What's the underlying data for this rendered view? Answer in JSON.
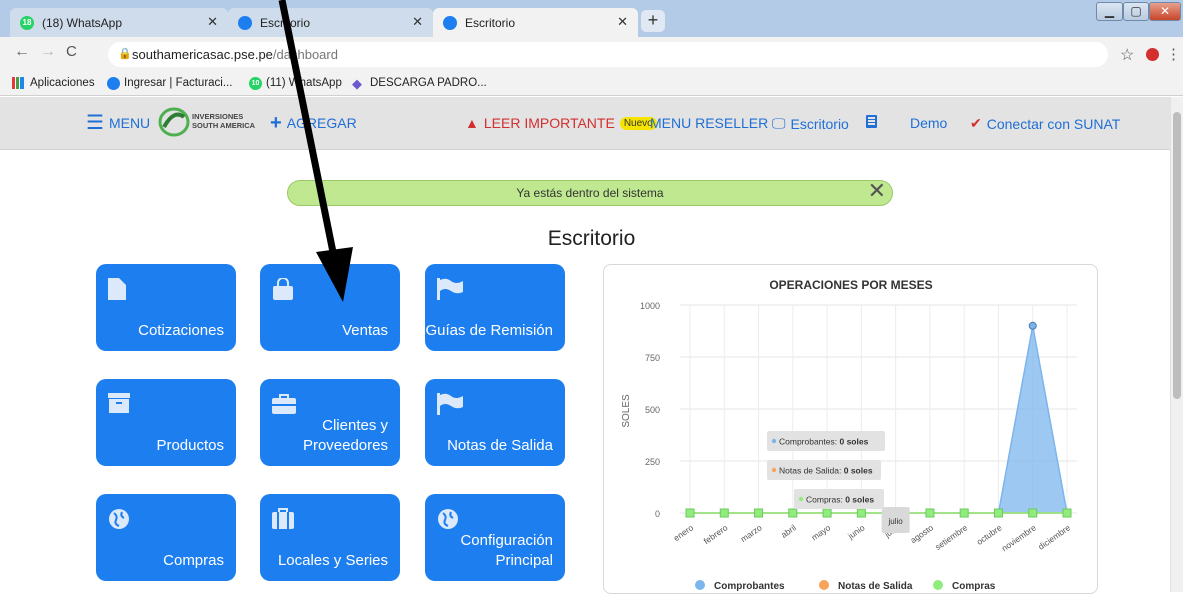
{
  "browser": {
    "tabs": [
      {
        "badge": "18",
        "label": "(18) WhatsApp"
      },
      {
        "label": "Escritorio"
      },
      {
        "label": "Escritorio"
      }
    ],
    "new_tab_label": "+",
    "url_host": "southamericasac.pse.pe",
    "url_path": "/dashboard"
  },
  "bookmarks": [
    {
      "label": "Aplicaciones"
    },
    {
      "label": "Ingresar | Facturaci..."
    },
    {
      "badge": "10",
      "label": "(11) WhatsApp"
    },
    {
      "label": "DESCARGA PADRO..."
    }
  ],
  "appnav": {
    "menu": "MENU",
    "logo_line1": "INVERSIONES",
    "logo_line2": "SOUTH AMERICA",
    "agregar": "AGREGAR",
    "leer": "LEER IMPORTANTE",
    "nuevo": "Nuevo",
    "reseller": "MENU RESELLER",
    "escritorio": "Escritorio",
    "demo": "Demo",
    "sunat": "Conectar con SUNAT"
  },
  "alert": {
    "text": "Ya estás dentro del sistema"
  },
  "page_title": "Escritorio",
  "tiles": [
    {
      "name": "tile-cotizaciones",
      "icon": "document-icon",
      "label": "Cotizaciones"
    },
    {
      "name": "tile-ventas",
      "icon": "shopping-bag-icon",
      "label": "Ventas"
    },
    {
      "name": "tile-guias",
      "icon": "flag-icon",
      "label": "Guías de Remisión"
    },
    {
      "name": "tile-productos",
      "icon": "archive-box-icon",
      "label": "Productos"
    },
    {
      "name": "tile-clientes",
      "icon": "briefcase-icon",
      "label": "Clientes y Proveedores"
    },
    {
      "name": "tile-notas",
      "icon": "flag-icon",
      "label": "Notas de Salida"
    },
    {
      "name": "tile-compras",
      "icon": "globe-icon",
      "label": "Compras"
    },
    {
      "name": "tile-locales",
      "icon": "luggage-icon",
      "label": "Locales y Series"
    },
    {
      "name": "tile-config",
      "icon": "globe-icon",
      "label": "Configuración Principal"
    }
  ],
  "chart_data": {
    "type": "area",
    "title": "OPERACIONES POR MESES",
    "ylabel": "SOLES",
    "ylim": [
      0,
      1000
    ],
    "yticks": [
      0,
      250,
      500,
      750,
      1000
    ],
    "grid": true,
    "legend": "bottom",
    "categories": [
      "enero",
      "febrero",
      "marzo",
      "abril",
      "mayo",
      "junio",
      "julio",
      "agosto",
      "setiembre",
      "octubre",
      "noviembre",
      "diciembre"
    ],
    "series": [
      {
        "name": "Comprobantes",
        "color": "#7cb5ec",
        "values": [
          0,
          0,
          0,
          0,
          0,
          0,
          0,
          0,
          0,
          0,
          900,
          0
        ]
      },
      {
        "name": "Notas de Salida",
        "color": "#f7a35c",
        "values": [
          0,
          0,
          0,
          0,
          0,
          0,
          0,
          0,
          0,
          0,
          0,
          0
        ]
      },
      {
        "name": "Compras",
        "color": "#90ed7d",
        "values": [
          0,
          0,
          0,
          0,
          0,
          0,
          0,
          0,
          0,
          0,
          0,
          0
        ]
      }
    ],
    "tooltip": {
      "category": "julio",
      "lines": [
        {
          "series": "Comprobantes",
          "text": "Comprobantes: ",
          "value": "0 soles"
        },
        {
          "series": "Notas de Salida",
          "text": "Notas de Salida: ",
          "value": "0 soles"
        },
        {
          "series": "Compras",
          "text": "Compras: ",
          "value": "0 soles"
        }
      ]
    }
  }
}
